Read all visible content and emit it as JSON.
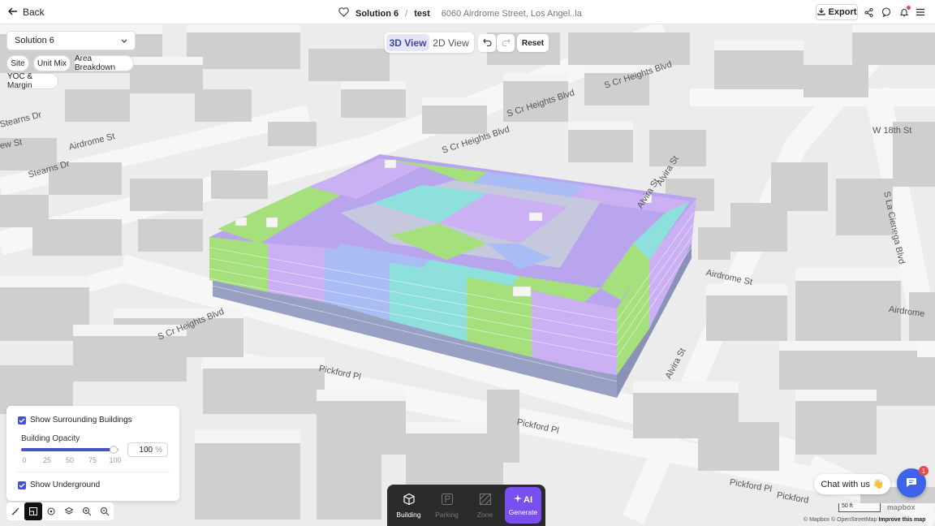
{
  "topbar": {
    "back_label": "Back",
    "solution_name": "Solution 6",
    "project_name": "test",
    "address": "6060 Airdrome Street, Los Angel..la",
    "export_label": "Export"
  },
  "controls": {
    "solution_select": "Solution 6",
    "tabs": [
      "Site",
      "Unit Mix",
      "Area Breakdown",
      "YOC & Margin"
    ]
  },
  "view": {
    "view_3d": "3D View",
    "view_2d": "2D View",
    "active": "3D View",
    "reset_label": "Reset"
  },
  "streets": {
    "s1": "S Cr Heights Blvd",
    "s2": "Airdrome St",
    "s3": "Stearns Dr",
    "s4": "S Cr Heights Blvd",
    "s5": "Pickford Pl",
    "s6": "Pickford Pl",
    "s7": "Alvira St",
    "s8": "Airdrome St",
    "s9": "Airdrome",
    "s10": "S La Cienega Blvd",
    "s11": "W 18th St",
    "s12": "Pickford Pl",
    "s13": "Pickford",
    "s14": "Alvira St",
    "s15": "Stearns Dr",
    "s16": "S Cr Heights Blvd",
    "s17": "Alvira St",
    "s18": "ew St",
    "s19": "S Cr Heights Blvd"
  },
  "panel": {
    "show_surrounding": "Show Surrounding Buildings",
    "opacity_label": "Building Opacity",
    "opacity_value": "100",
    "opacity_unit": "%",
    "ticks": [
      "0",
      "25",
      "50",
      "75",
      "100"
    ],
    "show_underground": "Show Underground"
  },
  "dock": {
    "building": "Building",
    "parking": "Parking",
    "zone": "Zone",
    "ai": "AI",
    "generate": "Generate"
  },
  "chat": {
    "bubble": "Chat with us 👋",
    "badge": "1"
  },
  "map": {
    "scale": "50 ft",
    "logo": "mapbox",
    "attribution_prefix": "© Mapbox © OpenStreetMap",
    "attribution_link": "Improve this map"
  },
  "colors": {
    "accent": "#4a52c8",
    "unit_green": "#a6e07d",
    "unit_purple": "#cbb1f3",
    "unit_blue": "#a9bdf4",
    "unit_teal": "#8ee0dd",
    "podium": "#a4abcd",
    "ai": "#7a4ff0"
  }
}
